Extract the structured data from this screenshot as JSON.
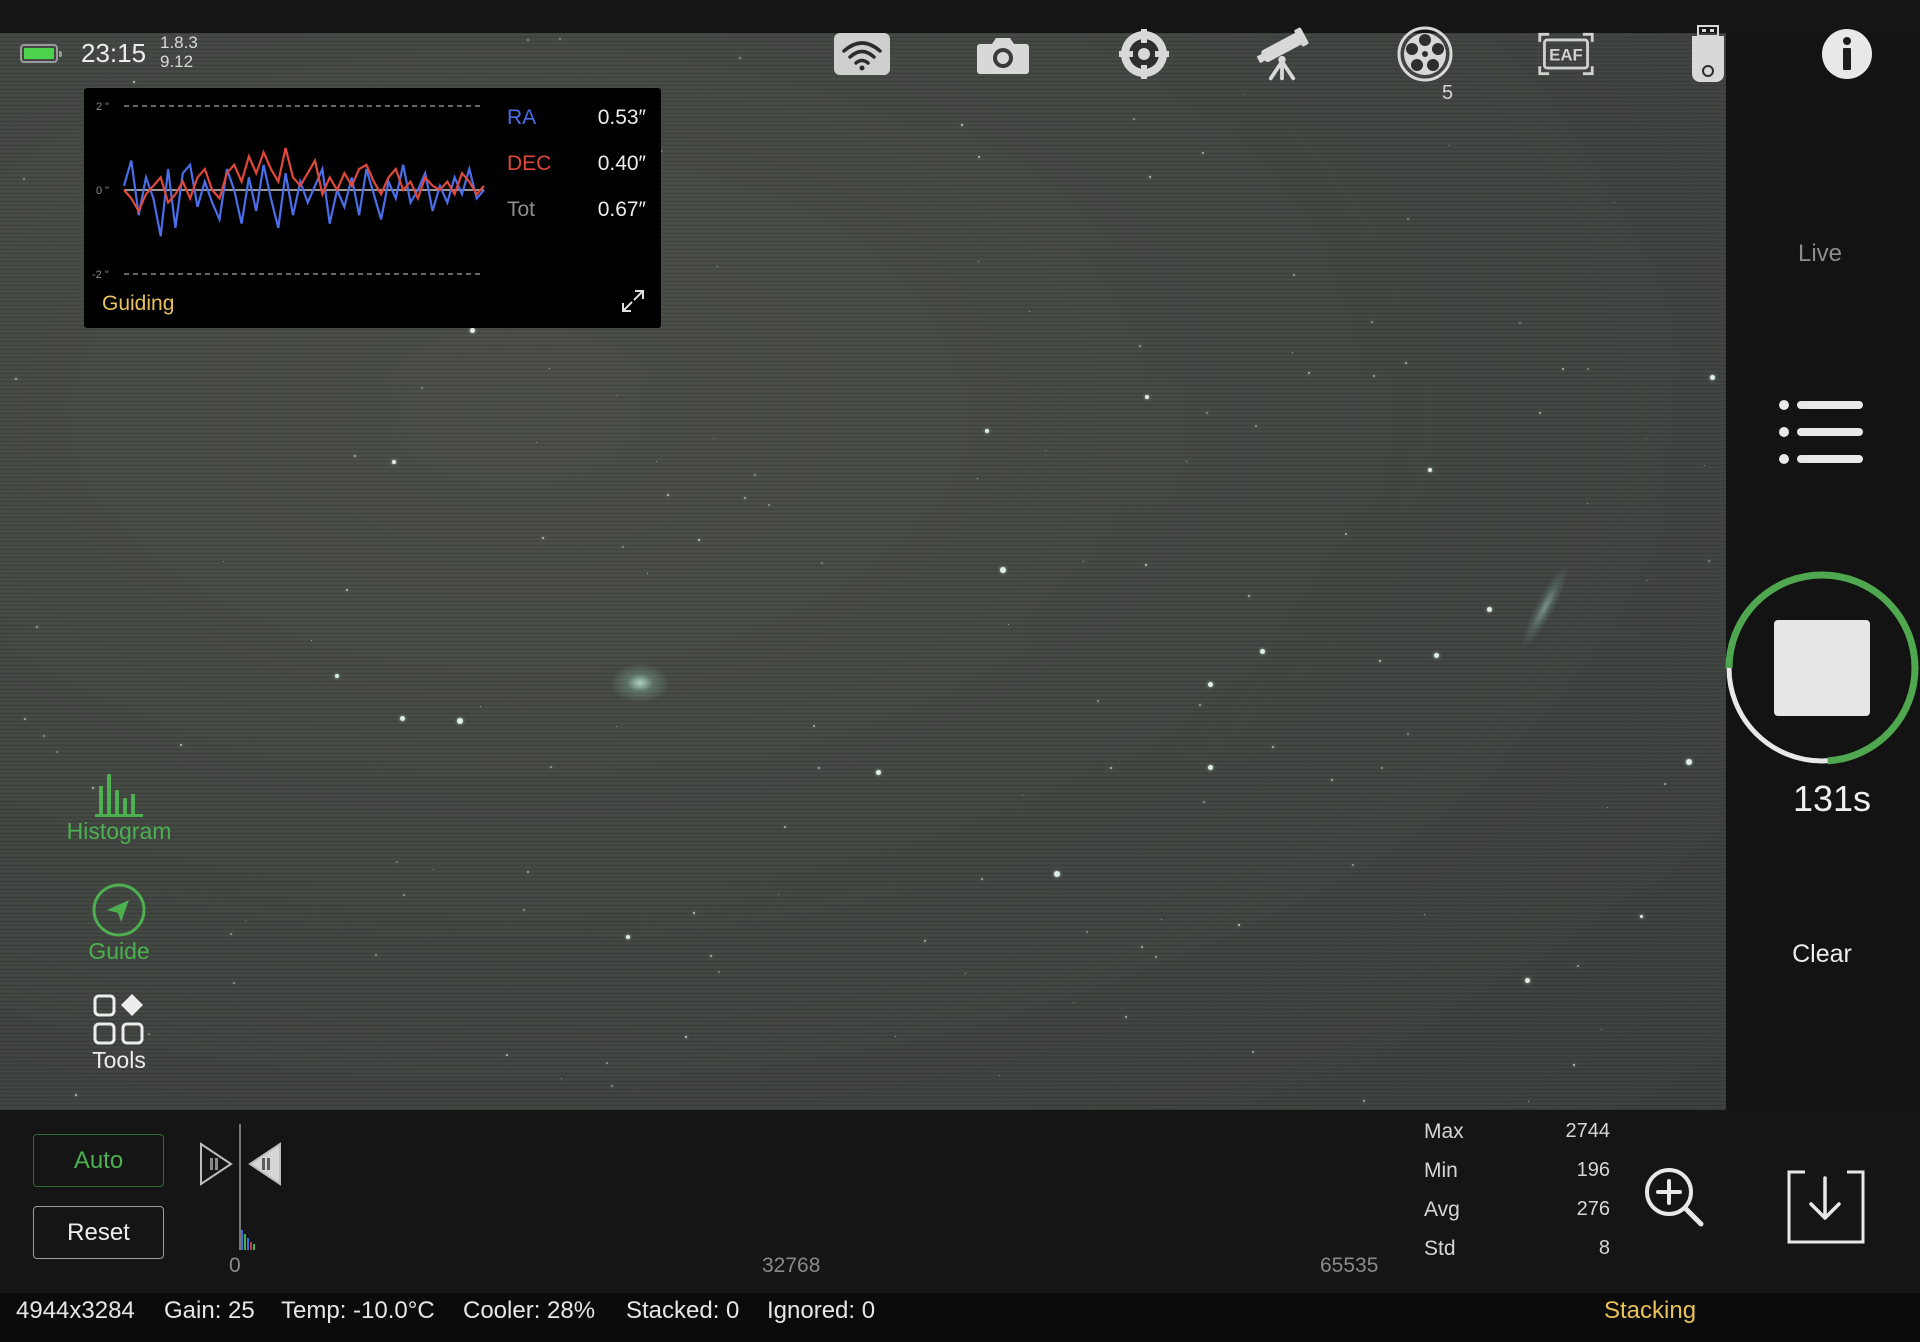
{
  "status": {
    "time": "23:15",
    "version_top": "1.8.3",
    "version_bottom": "9.12",
    "battery_level": 1.0,
    "battery_color": "#4cd24c"
  },
  "toolbar": {
    "icons": [
      "wifi-icon",
      "camera-icon",
      "crosshair-icon",
      "telescope-icon",
      "filter-wheel-icon",
      "eaf-icon",
      "usb-drive-icon",
      "info-icon"
    ],
    "eaf_label": "EAF",
    "filter_wheel_position": "5"
  },
  "guiding": {
    "title": "Guiding",
    "y_ticks": [
      "2 \"",
      "0 \"",
      "-2 \""
    ],
    "ra_label": "RA",
    "ra_value": "0.53″",
    "dec_label": "DEC",
    "dec_value": "0.40″",
    "tot_label": "Tot",
    "tot_value": "0.67″",
    "ra_color": "#4a6ee8",
    "dec_color": "#e0483c",
    "ra_series": [
      0.1,
      0.7,
      -0.6,
      0.3,
      -0.2,
      -1.1,
      0.5,
      -0.9,
      0.4,
      0.6,
      -0.4,
      0.2,
      -0.3,
      -0.7,
      0.5,
      0.0,
      -0.8,
      0.3,
      -0.5,
      0.6,
      -0.2,
      -0.9,
      0.4,
      -0.6,
      0.2,
      -0.3,
      0.1,
      0.5,
      -0.8,
      0.0,
      -0.4,
      0.3,
      -0.6,
      0.5,
      -0.1,
      -0.7,
      0.2,
      -0.2,
      0.6,
      -0.3,
      0.0,
      0.4,
      -0.5,
      0.1,
      -0.3,
      0.3,
      -0.1,
      0.5,
      -0.2,
      0.0
    ],
    "dec_series": [
      0.0,
      -0.2,
      -0.5,
      -0.1,
      0.1,
      0.3,
      -0.3,
      -0.1,
      0.2,
      -0.2,
      0.3,
      0.5,
      0.0,
      -0.2,
      0.4,
      0.6,
      0.2,
      0.8,
      0.4,
      0.9,
      0.5,
      0.2,
      1.0,
      0.3,
      0.1,
      0.4,
      0.7,
      -0.1,
      0.3,
      0.0,
      0.4,
      0.1,
      0.5,
      0.6,
      0.2,
      -0.1,
      0.3,
      0.5,
      0.0,
      0.2,
      -0.2,
      0.3,
      0.1,
      0.0,
      0.2,
      -0.1,
      0.4,
      0.2,
      -0.1,
      0.1
    ]
  },
  "left_tools": {
    "histogram": "Histogram",
    "guide": "Guide",
    "tools": "Tools"
  },
  "right_panel": {
    "live": "Live",
    "exposure_remaining": "131s",
    "exposure_progress": 0.74,
    "clear": "Clear"
  },
  "histogram": {
    "auto_label": "Auto",
    "reset_label": "Reset",
    "axis_min": "0",
    "axis_mid": "32768",
    "axis_max": "65535"
  },
  "stats": {
    "max_label": "Max",
    "max_value": "2744",
    "min_label": "Min",
    "min_value": "196",
    "avg_label": "Avg",
    "avg_value": "276",
    "std_label": "Std",
    "std_value": "8"
  },
  "statusbar": {
    "resolution": "4944x3284",
    "gain": "Gain: 25",
    "temp": "Temp: -10.0°C",
    "cooler": "Cooler: 28%",
    "stacked": "Stacked: 0",
    "ignored": "Ignored: 0",
    "mode": "Stacking"
  }
}
